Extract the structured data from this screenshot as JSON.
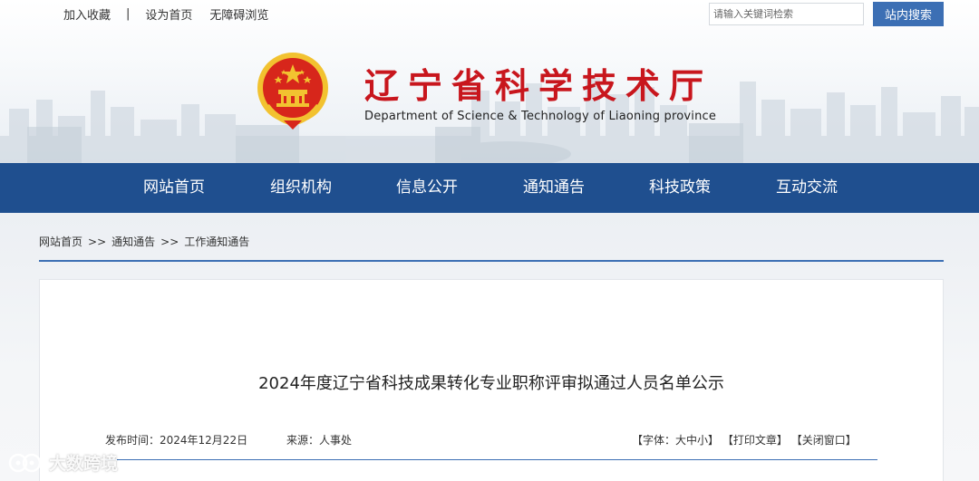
{
  "top_links": {
    "favorite": "加入收藏",
    "separator": "|",
    "homepage": "设为首页",
    "accessible": "无障碍浏览"
  },
  "search": {
    "placeholder": "请输入关键词检索",
    "button_label": "站内搜索"
  },
  "site": {
    "title_cn": "辽宁省科学技术厅",
    "title_en": "Department of Science & Technology of Liaoning province"
  },
  "nav": {
    "items": [
      {
        "label": "网站首页"
      },
      {
        "label": "组织机构"
      },
      {
        "label": "信息公开"
      },
      {
        "label": "通知通告"
      },
      {
        "label": "科技政策"
      },
      {
        "label": "互动交流"
      }
    ]
  },
  "breadcrumb": {
    "items": [
      "网站首页",
      "通知通告",
      "工作通知通告"
    ],
    "separator": ">>"
  },
  "article": {
    "title": "2024年度辽宁省科技成果转化专业职称评审拟通过人员名单公示",
    "date_label": "发布时间：2024年12月22日",
    "source_label": "来源：人事处",
    "tools": {
      "font": "【字体：大中小】",
      "print": "【打印文章】",
      "close": "【关闭窗口】"
    }
  },
  "watermark": {
    "text": "大数跨境"
  },
  "colors": {
    "nav_bg": "#1f4f8f",
    "accent_blue": "#3c6fb4",
    "title_red": "#c8161d",
    "emblem_red": "#d7261b",
    "emblem_gold": "#f2c230"
  }
}
